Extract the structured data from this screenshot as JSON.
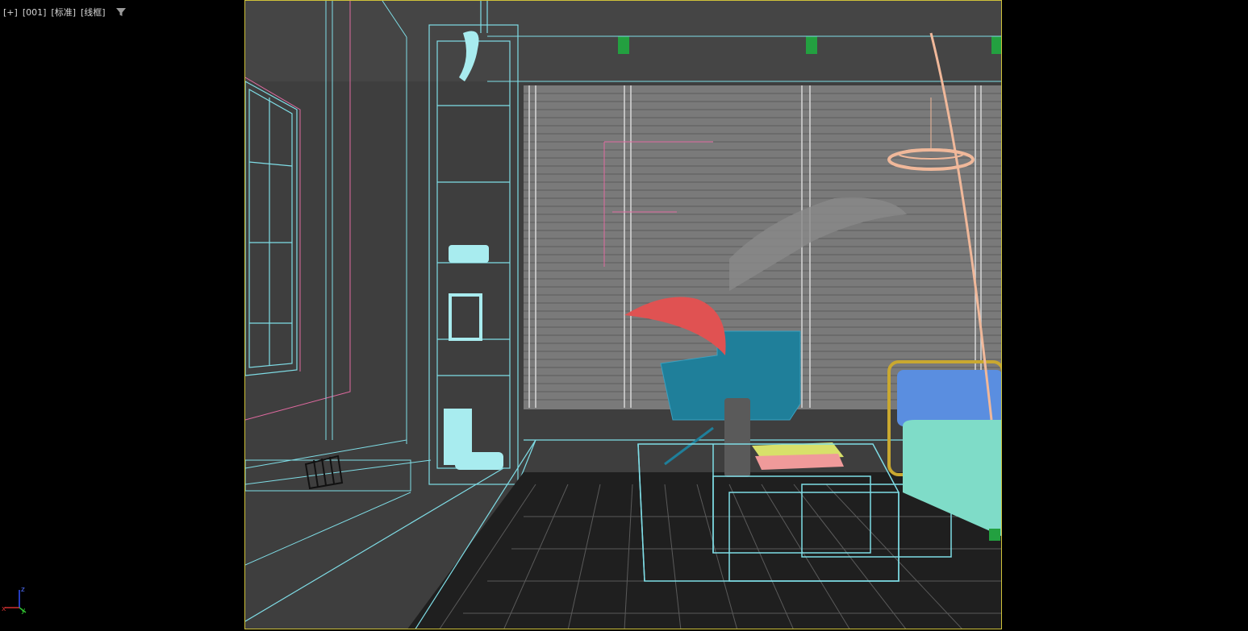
{
  "viewport": {
    "labels": [
      "[+]",
      "[001]",
      "[标准]",
      "[线框]"
    ],
    "filter_icon": "filter-icon",
    "border_color": "#cfc23a",
    "background_color": "#3e3e3e"
  },
  "axis_gizmo": {
    "x_label": "x",
    "y_label": "y",
    "z_label": "z",
    "x_color": "#d03030",
    "y_color": "#30c030",
    "z_color": "#3050ff"
  },
  "colors": {
    "wireframe_cyan": "#7fdde6",
    "wireframe_pink": "#e06aa0",
    "plant_red": "#e05252",
    "chair_teal": "#1f7f9a",
    "sofa_blue": "#5a8ee0",
    "sofa_mint": "#7fdcc8",
    "lamp_peach": "#f0b89a",
    "light_green": "#23a040"
  }
}
